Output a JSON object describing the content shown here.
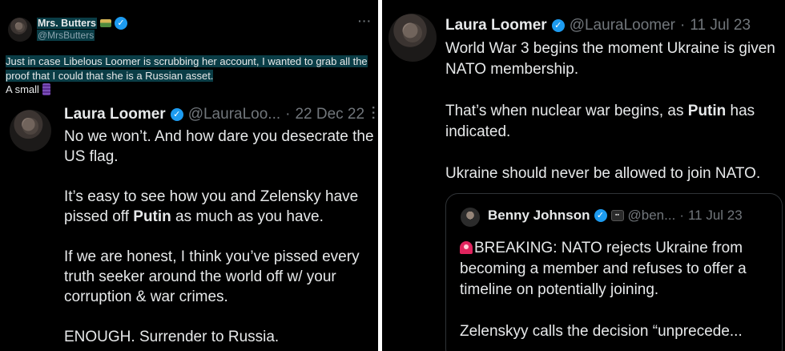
{
  "left": {
    "author": {
      "name": "Mrs. Butters",
      "handle": "@MrsButters"
    },
    "more_icon": "more-horizontal-icon",
    "text_line": "Just in case Libelous Loomer is scrubbing her account, I wanted to grab all the proof that I could that she is a Russian asset.",
    "text_line2": "A small",
    "quoted_tweet": {
      "name": "Laura Loomer",
      "handle": "@LauraLoo...",
      "date": "22 Dec 22",
      "separator": "·",
      "para1": "No we won’t. And how dare you desecrate the US flag.",
      "para2_a": "It’s easy to see how you and Zelensky have pissed off ",
      "para2_b": "Putin",
      "para2_c": " as much as you have.",
      "para3": "If we are honest, I think you’ve pissed every truth seeker around the world off w/ your corruption & war crimes.",
      "para4": "ENOUGH. Surrender to Russia."
    }
  },
  "right": {
    "tweet": {
      "name": "Laura Loomer",
      "handle": "@LauraLoomer",
      "separator": "·",
      "date": "11 Jul 23",
      "para1": "World War 3 begins the moment Ukraine is given NATO membership.",
      "para2_a": "That’s when nuclear war begins, as ",
      "para2_b": "Putin",
      "para2_c": " has indicated.",
      "para3": "Ukraine should never be allowed to join NATO."
    },
    "quote": {
      "name": "Benny Johnson",
      "handle": "@ben...",
      "separator": "·",
      "date": "11 Jul 23",
      "para1": "BREAKING: NATO rejects Ukraine from becoming a member and refuses to offer a timeline on potentially joining.",
      "para2": "Zelenskyy calls the decision “unprecede..."
    }
  },
  "colors": {
    "background": "#000000",
    "text": "#e7e9ea",
    "muted": "#71767b",
    "verified": "#1d9bf0",
    "highlight": "#0a3d46"
  }
}
